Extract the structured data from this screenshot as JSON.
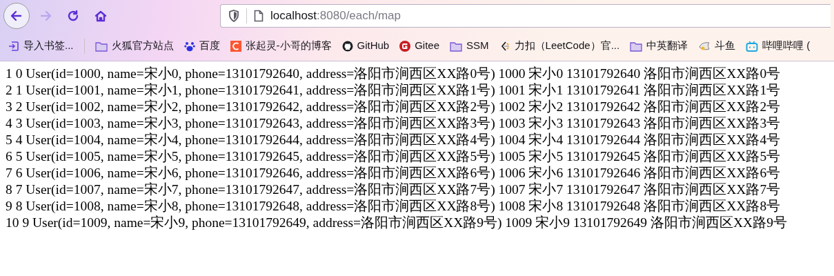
{
  "toolbar": {
    "nav_buttons": [
      {
        "kind": "back",
        "disabled": false
      },
      {
        "kind": "forward",
        "disabled": true
      },
      {
        "kind": "reload",
        "disabled": false
      },
      {
        "kind": "home",
        "disabled": false
      }
    ],
    "url": {
      "host": "localhost",
      "rest": ":8080/each/map"
    }
  },
  "bookmarks": [
    {
      "kind": "import",
      "label": "导入书签..."
    },
    {
      "kind": "folder",
      "label": "火狐官方站点"
    },
    {
      "kind": "paw",
      "label": "百度"
    },
    {
      "kind": "c-logo",
      "label": "张起灵-小哥的博客"
    },
    {
      "kind": "github",
      "label": "GitHub"
    },
    {
      "kind": "gitee",
      "label": "Gitee"
    },
    {
      "kind": "folder",
      "label": "SSM"
    },
    {
      "kind": "leetcode",
      "label": "力扣（LeetCode）官..."
    },
    {
      "kind": "folder",
      "label": "中英翻译"
    },
    {
      "kind": "fish",
      "label": "斗鱼"
    },
    {
      "kind": "tv",
      "label": "哔哩哔哩 ("
    }
  ],
  "lines": [
    "1 0 User(id=1000, name=宋小0, phone=13101792640, address=洛阳市涧西区XX路0号) 1000 宋小0 13101792640 洛阳市涧西区XX路0号",
    "2 1 User(id=1001, name=宋小1, phone=13101792641, address=洛阳市涧西区XX路1号) 1001 宋小1 13101792641 洛阳市涧西区XX路1号",
    "3 2 User(id=1002, name=宋小2, phone=13101792642, address=洛阳市涧西区XX路2号) 1002 宋小2 13101792642 洛阳市涧西区XX路2号",
    "4 3 User(id=1003, name=宋小3, phone=13101792643, address=洛阳市涧西区XX路3号) 1003 宋小3 13101792643 洛阳市涧西区XX路3号",
    "5 4 User(id=1004, name=宋小4, phone=13101792644, address=洛阳市涧西区XX路4号) 1004 宋小4 13101792644 洛阳市涧西区XX路4号",
    "6 5 User(id=1005, name=宋小5, phone=13101792645, address=洛阳市涧西区XX路5号) 1005 宋小5 13101792645 洛阳市涧西区XX路5号",
    "7 6 User(id=1006, name=宋小6, phone=13101792646, address=洛阳市涧西区XX路6号) 1006 宋小6 13101792646 洛阳市涧西区XX路6号",
    "8 7 User(id=1007, name=宋小7, phone=13101792647, address=洛阳市涧西区XX路7号) 1007 宋小7 13101792647 洛阳市涧西区XX路7号",
    "9 8 User(id=1008, name=宋小8, phone=13101792648, address=洛阳市涧西区XX路8号) 1008 宋小8 13101792648 洛阳市涧西区XX路8号",
    "10 9 User(id=1009, name=宋小9, phone=13101792649, address=洛阳市涧西区XX路9号) 1009 宋小9 13101792649 洛阳市涧西区XX路9号"
  ]
}
